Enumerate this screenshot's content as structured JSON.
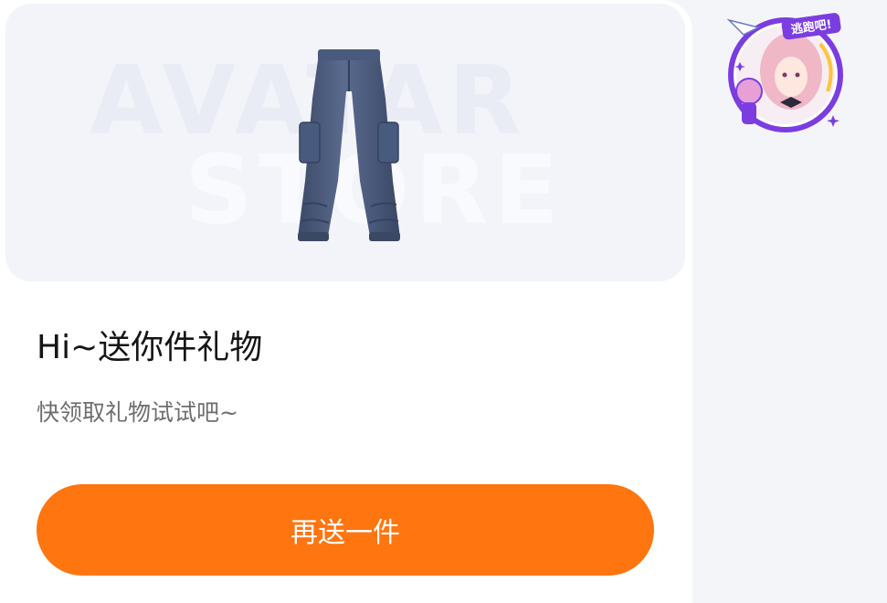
{
  "gift_card": {
    "product_image": {
      "icon": "cargo-pants-icon",
      "watermark_line1": "AVATAR",
      "watermark_line2": "STORE"
    },
    "title": "Hi~送你件礼物",
    "subtitle": "快领取礼物试试吧~",
    "send_button_label": "再送一件"
  },
  "sender": {
    "avatar_badge": "逃跑吧!"
  },
  "colors": {
    "accent": "#ff7510",
    "product_bg": "#f2f4fa",
    "page_bg": "#f4f5f9",
    "pants": "#4d5e80",
    "avatar_ring": "#7b3de0"
  }
}
